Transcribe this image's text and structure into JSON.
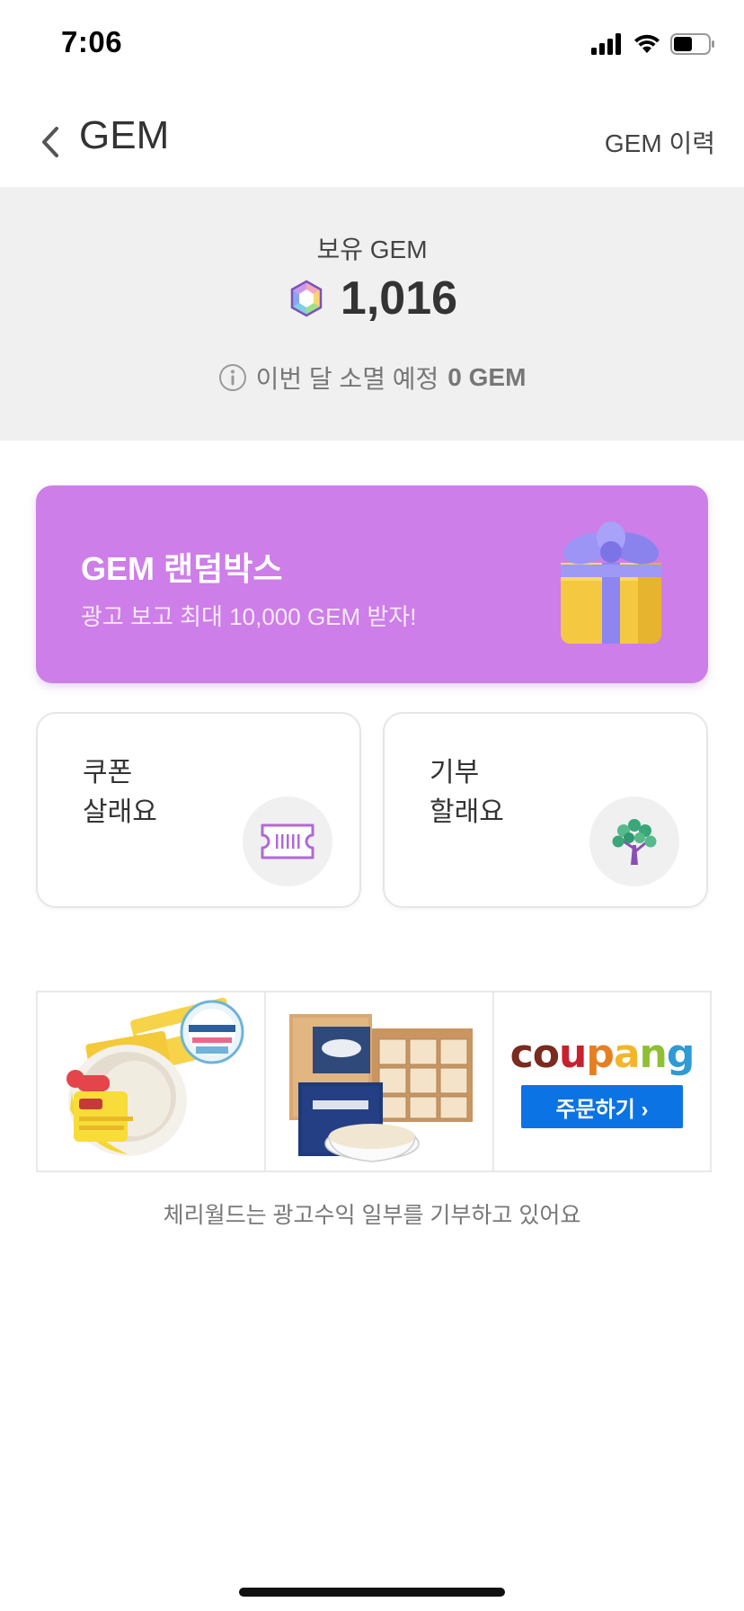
{
  "status_bar": {
    "time": "7:06"
  },
  "header": {
    "title": "GEM",
    "history_label": "GEM 이력"
  },
  "balance": {
    "label": "보유 GEM",
    "amount": "1,016",
    "expire_text": "이번 달 소멸 예정",
    "expire_value": "0 GEM"
  },
  "random_box": {
    "title": "GEM 랜덤박스",
    "subtitle": "광고 보고 최대 10,000 GEM 받자!"
  },
  "cards": {
    "coupon": {
      "line1": "쿠폰",
      "line2": "살래요"
    },
    "donate": {
      "line1": "기부",
      "line2": "할래요"
    }
  },
  "ad": {
    "coupang_logo": "coupang",
    "order_button": "주문하기 ›"
  },
  "footnote": "체리월드는 광고수익 일부를 기부하고 있어요",
  "colors": {
    "banner": "#cd7ee8",
    "accent_purple": "#a85ad0",
    "coupang_blue": "#0b73e3"
  }
}
